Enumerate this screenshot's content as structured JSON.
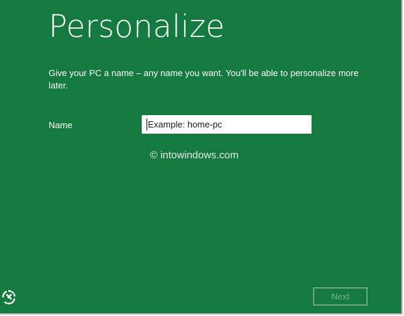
{
  "page": {
    "title": "Personalize",
    "description": "Give your PC a name – any name you want. You'll be able to personalize more later."
  },
  "form": {
    "name_label": "Name",
    "name_value": "",
    "name_placeholder": "Example: home-pc"
  },
  "watermark": "© intowindows.com",
  "footer": {
    "next_label": "Next",
    "ease_of_access_icon": "ease-of-access-icon"
  },
  "colors": {
    "background": "#157a3f",
    "text": "#ffffff",
    "input_background": "#ffffff",
    "next_disabled": "#7eb092"
  }
}
